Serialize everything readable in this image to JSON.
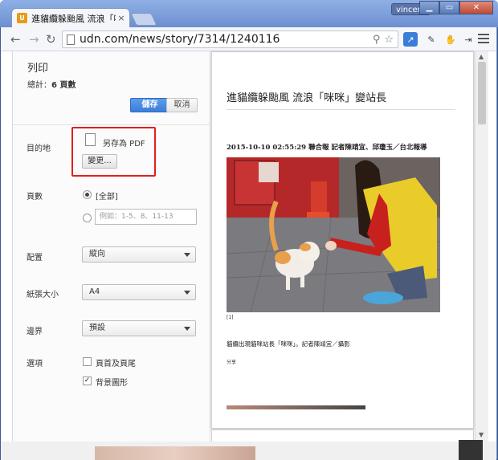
{
  "browser": {
    "tab_title": "進貓纜躲颱風 流浪「咪咪」",
    "tab_close": "×",
    "user": "vincent",
    "url": "udn.com/news/story/7314/1240116",
    "controls": {
      "minimize": "▁",
      "maximize": "▭",
      "close": "✕"
    },
    "nav": {
      "back": "←",
      "forward": "→",
      "reload": "↻"
    }
  },
  "print": {
    "title": "列印",
    "total_prefix": "總計：",
    "total_pages": "6 頁數",
    "save_label": "儲存",
    "cancel_label": "取消",
    "destination": {
      "label": "目的地",
      "value": "另存為 PDF",
      "change_label": "變更..."
    },
    "pages": {
      "label": "頁數",
      "all_option": "[全部]",
      "range_placeholder": "例如：1-5、8、11-13"
    },
    "layout": {
      "label": "配置",
      "value": "縱向"
    },
    "paper_size": {
      "label": "紙張大小",
      "value": "A4"
    },
    "margins": {
      "label": "邊界",
      "value": "預設"
    },
    "options": {
      "label": "選項",
      "header_footer": {
        "label": "頁首及頁尾",
        "checked": false
      },
      "background": {
        "label": "背景圖形",
        "checked": true
      }
    }
  },
  "preview": {
    "article_title": "進貓纜躲颱風 流浪「咪咪」變站長",
    "meta": "2015-10-10 02:55:29 聯合報 記者陳靖宜、邱瓊玉／台北報導",
    "ref": "[1]",
    "caption": "貓纜出現貓咪站長「咪咪」。記者陳靖宜／攝影",
    "share": "分享"
  },
  "colors": {
    "accent_blue": "#3b7dd8",
    "highlight_red": "#e02020"
  }
}
